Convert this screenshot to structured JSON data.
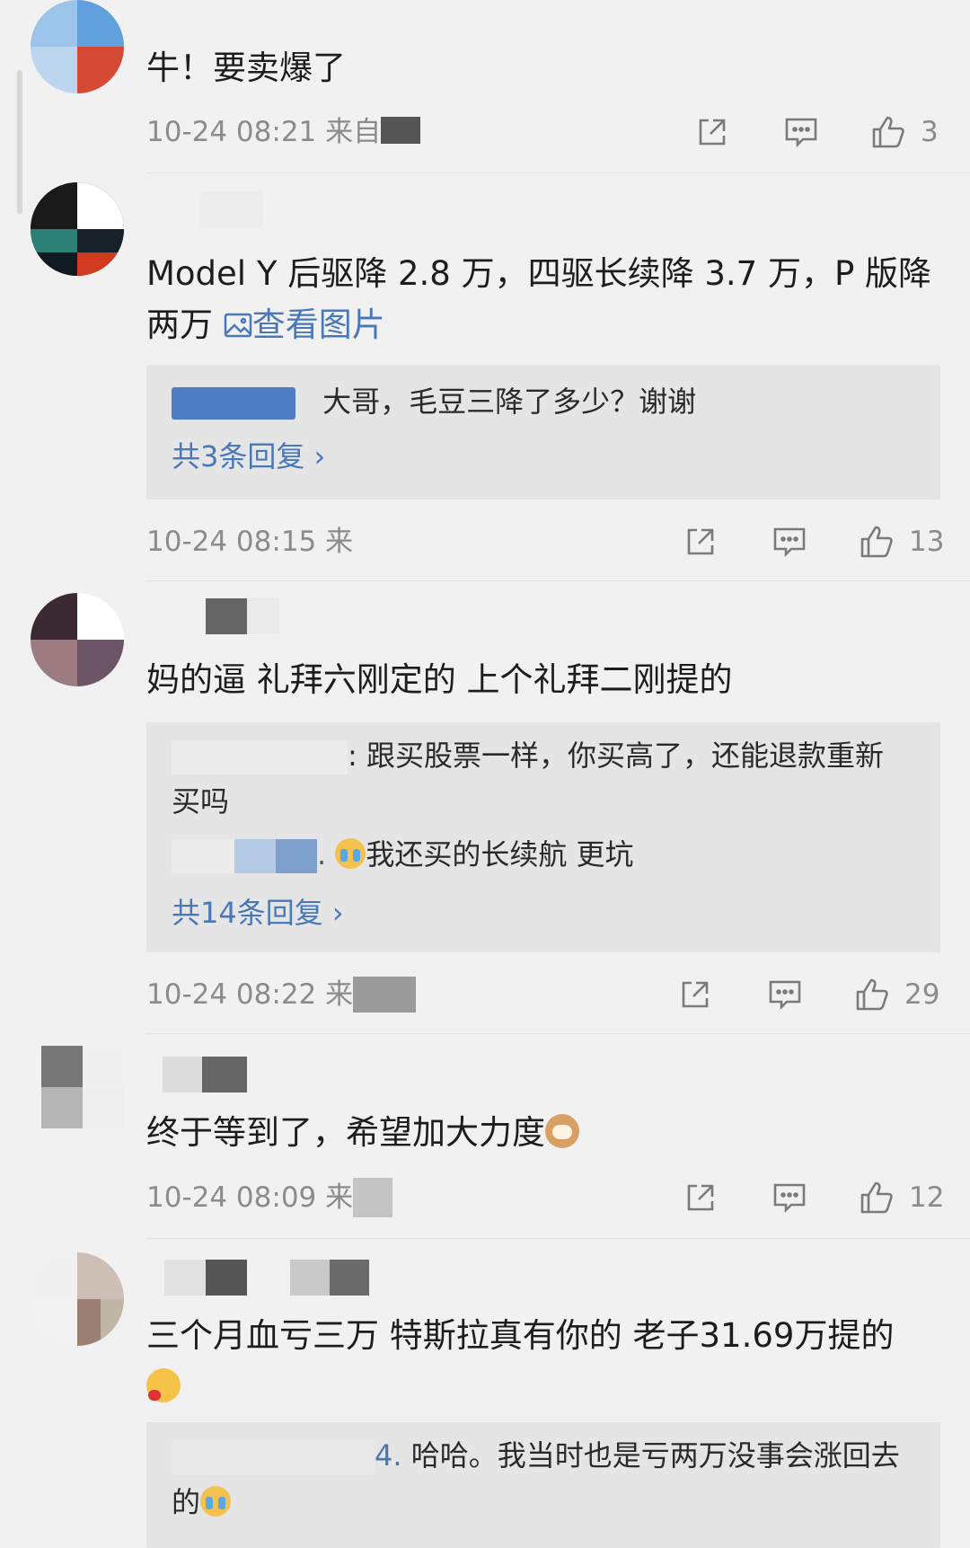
{
  "comments": [
    {
      "text": "牛！要卖爆了",
      "time": "10-24 08:21",
      "source_prefix": "来自",
      "likes": "3"
    },
    {
      "text": "Model Y 后驱降 2.8 万，四驱长续降 3.7 万，P 版降两万",
      "link": "查看图片",
      "reply1": "大哥，毛豆三降了多少？谢谢",
      "more_replies": "共3条回复 ›",
      "time": "10-24 08:15",
      "source_prefix": "来",
      "likes": "13"
    },
    {
      "text": "妈的逼 礼拜六刚定的 上个礼拜二刚提的",
      "reply1_line1": ": 跟买股票一样，你买高了，还能退款重新",
      "reply1_line2": "买吗",
      "reply2": "我还买的长续航 更坑",
      "more_replies": "共14条回复 ›",
      "time": "10-24 08:22",
      "source_prefix": "来",
      "likes": "29"
    },
    {
      "text": "终于等到了，希望加大力度",
      "time": "10-24 08:09",
      "source_prefix": "来",
      "likes": "12"
    },
    {
      "text_line1": "三个月血亏三万 特斯拉真有你的 老子31.69万提的",
      "reply1_line1": "哈哈。我当时也是亏两万没事会涨回去",
      "reply1_line2": "的"
    }
  ],
  "icons": [
    "share-icon",
    "comment-icon",
    "like-icon",
    "image-icon",
    "chevron-right-icon"
  ],
  "colors": {
    "link": "#4a78b7",
    "background": "#f1f1f1",
    "reply_bg": "#e5e5e5",
    "meta": "#8b8b8b"
  }
}
